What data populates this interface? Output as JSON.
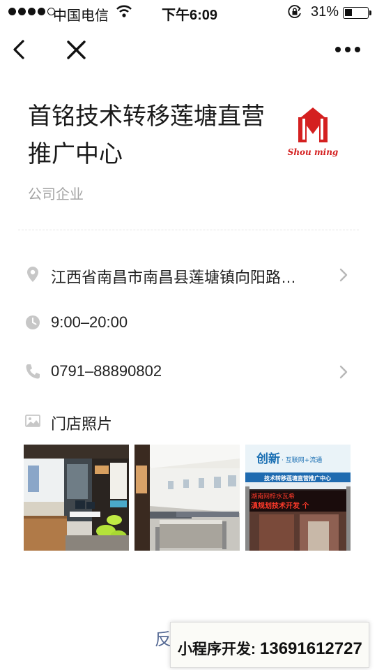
{
  "status_bar": {
    "carrier": "中国电信",
    "time": "下午6:09",
    "battery_percent": "31%",
    "battery_level": 0.31
  },
  "nav": {
    "back_icon": "chevron-left-icon",
    "close_icon": "close-icon",
    "more_icon": "more-dots-icon"
  },
  "store": {
    "title_line1": "首铭技术转移莲塘直营",
    "title_line2": "推广中心",
    "category": "公司企业",
    "logo_text": "Shou ming"
  },
  "info": {
    "address": "江西省南昌市南昌县莲塘镇向阳路…",
    "hours": "9:00–20:00",
    "phone": "0791–88890802",
    "photos_label": "门店照片"
  },
  "photos": [
    {
      "alt": "office-reception-photo"
    },
    {
      "alt": "office-workstations-photo"
    },
    {
      "alt": "storefront-photo",
      "sign_main": "创新",
      "sign_sub": "· 互联网+流通",
      "sign_band": "技术转移莲塘直营推广中心",
      "led_line1": "湖南网梓水瓦希",
      "led_line2": "滇规划技术开发 个"
    }
  ],
  "footer": {
    "feedback_text": "反",
    "dev_label": "小程序开发:",
    "dev_phone": "13691612727"
  },
  "colors": {
    "accent": "#576b95",
    "icon_gray": "#c7c7c7",
    "text_secondary": "#a3a3a3",
    "logo_red": "#d42020"
  }
}
